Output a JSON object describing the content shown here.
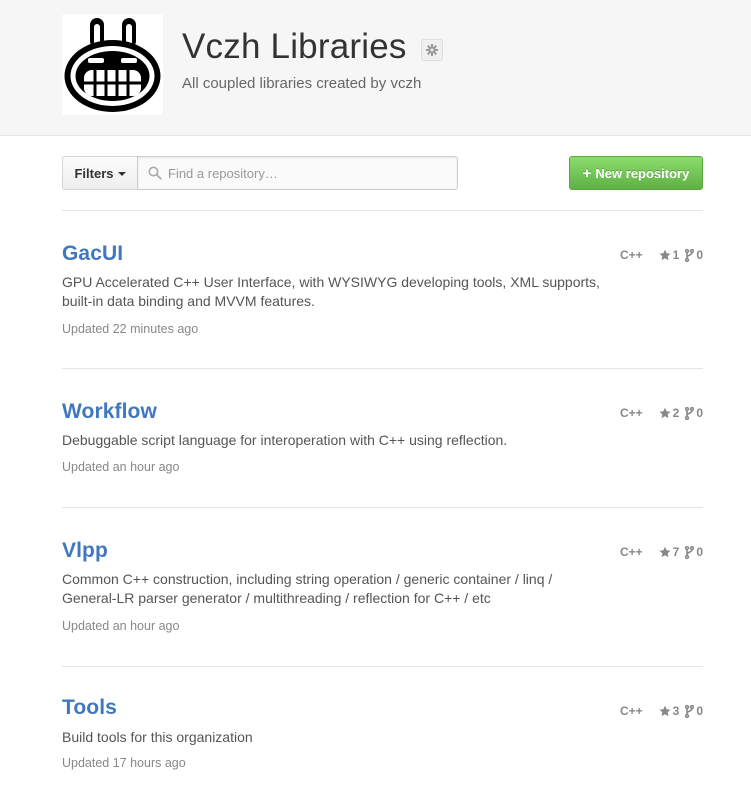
{
  "org": {
    "name": "Vczh Libraries",
    "description": "All coupled libraries created by vczh"
  },
  "toolbar": {
    "filters_label": "Filters",
    "search_placeholder": "Find a repository…",
    "search_value": "",
    "new_repo_label": "New repository",
    "new_repo_plus": "+"
  },
  "repos": [
    {
      "name": "GacUI",
      "description": "GPU Accelerated C++ User Interface, with WYSIWYG developing tools, XML supports, built-in data binding and MVVM features.",
      "updated": "Updated 22 minutes ago",
      "language": "C++",
      "stars": "1",
      "forks": "0"
    },
    {
      "name": "Workflow",
      "description": "Debuggable script language for interoperation with C++ using reflection.",
      "updated": "Updated an hour ago",
      "language": "C++",
      "stars": "2",
      "forks": "0"
    },
    {
      "name": "Vlpp",
      "description": "Common C++ construction, including string operation / generic container / linq / General-LR parser generator / multithreading / reflection for C++ / etc",
      "updated": "Updated an hour ago",
      "language": "C++",
      "stars": "7",
      "forks": "0"
    },
    {
      "name": "Tools",
      "description": "Build tools for this organization",
      "updated": "Updated 17 hours ago",
      "language": "C++",
      "stars": "3",
      "forks": "0"
    }
  ],
  "icons": {
    "settings": "gear-icon",
    "search": "search-icon",
    "dropdown": "caret-down-icon",
    "star": "star-icon",
    "fork": "fork-icon",
    "avatar": "bunny-face-avatar"
  },
  "colors": {
    "link": "#4078c0",
    "new_button": "#60b044",
    "header_bg": "#f6f6f6"
  }
}
